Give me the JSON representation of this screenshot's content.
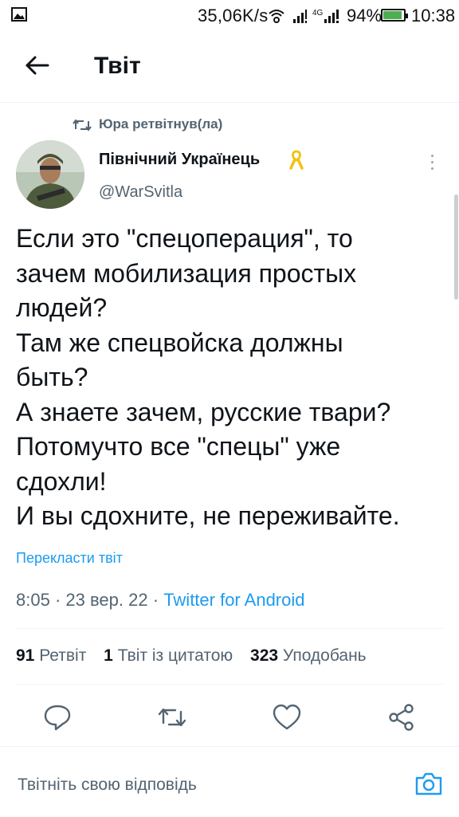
{
  "status_bar": {
    "network_speed": "35,06K/s",
    "network_type": "4G",
    "battery": "94%",
    "time": "10:38",
    "icons": [
      "image-icon",
      "wifi-icon",
      "signal-icon",
      "battery-icon"
    ]
  },
  "header": {
    "title": "Твіт",
    "back_icon": "arrow-left-icon"
  },
  "retweet_context": {
    "text": "Юра ретвітнув(ла)",
    "icon": "retweet-icon"
  },
  "author": {
    "name": "Північний Українець",
    "handle": "@WarSvitla",
    "badge_icon": "yellow-ribbon-icon"
  },
  "tweet": {
    "lines": [
      "Если это \"спецоперация\", то",
      "зачем мобилизация простых",
      "людей?",
      "Там же спецвойска должны",
      "быть?",
      "А знаете зачем, русские твари?",
      "Потомучто все \"спецы\" уже",
      "сдохли!",
      "И вы сдохните, не переживайте."
    ],
    "translate_label": "Перекласти твіт",
    "time": "8:05",
    "date": "23 вер. 22",
    "separator": "·",
    "client": "Twitter for Android"
  },
  "stats": {
    "retweets_count": "91",
    "retweets_label": "Ретвіт",
    "quotes_count": "1",
    "quotes_label": "Твіт із цитатою",
    "likes_count": "323",
    "likes_label": "Уподобань"
  },
  "actions": [
    "reply-icon",
    "retweet-icon",
    "like-icon",
    "share-icon"
  ],
  "reply": {
    "placeholder": "Твітніть свою відповідь",
    "camera_icon": "camera-icon"
  },
  "colors": {
    "accent": "#1d9bf0",
    "text_primary": "#0f1419",
    "text_secondary": "#536471",
    "divider": "#eff3f4",
    "battery_fill": "#4caf50",
    "ribbon": "#f2c20f"
  }
}
